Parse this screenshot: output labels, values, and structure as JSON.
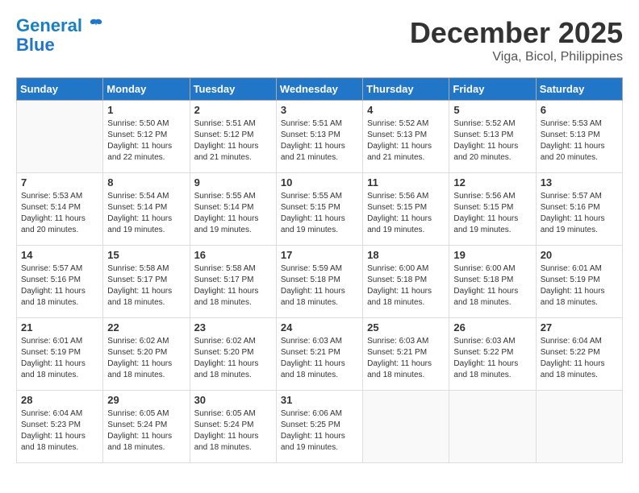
{
  "header": {
    "logo_line1": "General",
    "logo_line2": "Blue",
    "month": "December 2025",
    "location": "Viga, Bicol, Philippines"
  },
  "weekdays": [
    "Sunday",
    "Monday",
    "Tuesday",
    "Wednesday",
    "Thursday",
    "Friday",
    "Saturday"
  ],
  "weeks": [
    [
      {
        "day": "",
        "sunrise": "",
        "sunset": "",
        "daylight": ""
      },
      {
        "day": "1",
        "sunrise": "Sunrise: 5:50 AM",
        "sunset": "Sunset: 5:12 PM",
        "daylight": "Daylight: 11 hours and 22 minutes."
      },
      {
        "day": "2",
        "sunrise": "Sunrise: 5:51 AM",
        "sunset": "Sunset: 5:12 PM",
        "daylight": "Daylight: 11 hours and 21 minutes."
      },
      {
        "day": "3",
        "sunrise": "Sunrise: 5:51 AM",
        "sunset": "Sunset: 5:13 PM",
        "daylight": "Daylight: 11 hours and 21 minutes."
      },
      {
        "day": "4",
        "sunrise": "Sunrise: 5:52 AM",
        "sunset": "Sunset: 5:13 PM",
        "daylight": "Daylight: 11 hours and 21 minutes."
      },
      {
        "day": "5",
        "sunrise": "Sunrise: 5:52 AM",
        "sunset": "Sunset: 5:13 PM",
        "daylight": "Daylight: 11 hours and 20 minutes."
      },
      {
        "day": "6",
        "sunrise": "Sunrise: 5:53 AM",
        "sunset": "Sunset: 5:13 PM",
        "daylight": "Daylight: 11 hours and 20 minutes."
      }
    ],
    [
      {
        "day": "7",
        "sunrise": "Sunrise: 5:53 AM",
        "sunset": "Sunset: 5:14 PM",
        "daylight": "Daylight: 11 hours and 20 minutes."
      },
      {
        "day": "8",
        "sunrise": "Sunrise: 5:54 AM",
        "sunset": "Sunset: 5:14 PM",
        "daylight": "Daylight: 11 hours and 19 minutes."
      },
      {
        "day": "9",
        "sunrise": "Sunrise: 5:55 AM",
        "sunset": "Sunset: 5:14 PM",
        "daylight": "Daylight: 11 hours and 19 minutes."
      },
      {
        "day": "10",
        "sunrise": "Sunrise: 5:55 AM",
        "sunset": "Sunset: 5:15 PM",
        "daylight": "Daylight: 11 hours and 19 minutes."
      },
      {
        "day": "11",
        "sunrise": "Sunrise: 5:56 AM",
        "sunset": "Sunset: 5:15 PM",
        "daylight": "Daylight: 11 hours and 19 minutes."
      },
      {
        "day": "12",
        "sunrise": "Sunrise: 5:56 AM",
        "sunset": "Sunset: 5:15 PM",
        "daylight": "Daylight: 11 hours and 19 minutes."
      },
      {
        "day": "13",
        "sunrise": "Sunrise: 5:57 AM",
        "sunset": "Sunset: 5:16 PM",
        "daylight": "Daylight: 11 hours and 19 minutes."
      }
    ],
    [
      {
        "day": "14",
        "sunrise": "Sunrise: 5:57 AM",
        "sunset": "Sunset: 5:16 PM",
        "daylight": "Daylight: 11 hours and 18 minutes."
      },
      {
        "day": "15",
        "sunrise": "Sunrise: 5:58 AM",
        "sunset": "Sunset: 5:17 PM",
        "daylight": "Daylight: 11 hours and 18 minutes."
      },
      {
        "day": "16",
        "sunrise": "Sunrise: 5:58 AM",
        "sunset": "Sunset: 5:17 PM",
        "daylight": "Daylight: 11 hours and 18 minutes."
      },
      {
        "day": "17",
        "sunrise": "Sunrise: 5:59 AM",
        "sunset": "Sunset: 5:18 PM",
        "daylight": "Daylight: 11 hours and 18 minutes."
      },
      {
        "day": "18",
        "sunrise": "Sunrise: 6:00 AM",
        "sunset": "Sunset: 5:18 PM",
        "daylight": "Daylight: 11 hours and 18 minutes."
      },
      {
        "day": "19",
        "sunrise": "Sunrise: 6:00 AM",
        "sunset": "Sunset: 5:18 PM",
        "daylight": "Daylight: 11 hours and 18 minutes."
      },
      {
        "day": "20",
        "sunrise": "Sunrise: 6:01 AM",
        "sunset": "Sunset: 5:19 PM",
        "daylight": "Daylight: 11 hours and 18 minutes."
      }
    ],
    [
      {
        "day": "21",
        "sunrise": "Sunrise: 6:01 AM",
        "sunset": "Sunset: 5:19 PM",
        "daylight": "Daylight: 11 hours and 18 minutes."
      },
      {
        "day": "22",
        "sunrise": "Sunrise: 6:02 AM",
        "sunset": "Sunset: 5:20 PM",
        "daylight": "Daylight: 11 hours and 18 minutes."
      },
      {
        "day": "23",
        "sunrise": "Sunrise: 6:02 AM",
        "sunset": "Sunset: 5:20 PM",
        "daylight": "Daylight: 11 hours and 18 minutes."
      },
      {
        "day": "24",
        "sunrise": "Sunrise: 6:03 AM",
        "sunset": "Sunset: 5:21 PM",
        "daylight": "Daylight: 11 hours and 18 minutes."
      },
      {
        "day": "25",
        "sunrise": "Sunrise: 6:03 AM",
        "sunset": "Sunset: 5:21 PM",
        "daylight": "Daylight: 11 hours and 18 minutes."
      },
      {
        "day": "26",
        "sunrise": "Sunrise: 6:03 AM",
        "sunset": "Sunset: 5:22 PM",
        "daylight": "Daylight: 11 hours and 18 minutes."
      },
      {
        "day": "27",
        "sunrise": "Sunrise: 6:04 AM",
        "sunset": "Sunset: 5:22 PM",
        "daylight": "Daylight: 11 hours and 18 minutes."
      }
    ],
    [
      {
        "day": "28",
        "sunrise": "Sunrise: 6:04 AM",
        "sunset": "Sunset: 5:23 PM",
        "daylight": "Daylight: 11 hours and 18 minutes."
      },
      {
        "day": "29",
        "sunrise": "Sunrise: 6:05 AM",
        "sunset": "Sunset: 5:24 PM",
        "daylight": "Daylight: 11 hours and 18 minutes."
      },
      {
        "day": "30",
        "sunrise": "Sunrise: 6:05 AM",
        "sunset": "Sunset: 5:24 PM",
        "daylight": "Daylight: 11 hours and 18 minutes."
      },
      {
        "day": "31",
        "sunrise": "Sunrise: 6:06 AM",
        "sunset": "Sunset: 5:25 PM",
        "daylight": "Daylight: 11 hours and 19 minutes."
      },
      {
        "day": "",
        "sunrise": "",
        "sunset": "",
        "daylight": ""
      },
      {
        "day": "",
        "sunrise": "",
        "sunset": "",
        "daylight": ""
      },
      {
        "day": "",
        "sunrise": "",
        "sunset": "",
        "daylight": ""
      }
    ]
  ]
}
